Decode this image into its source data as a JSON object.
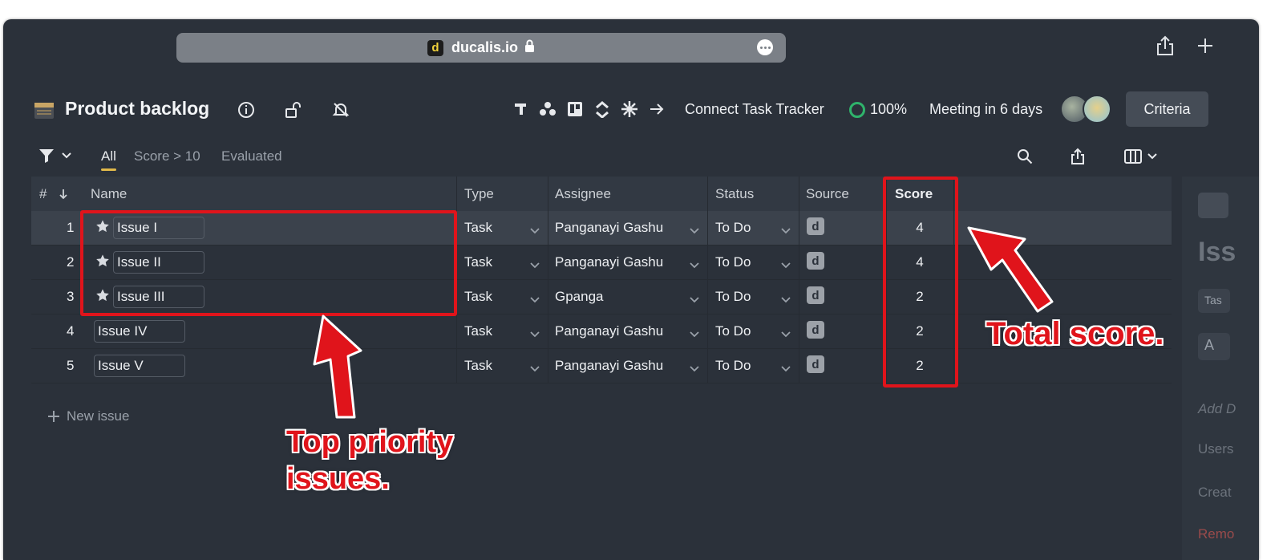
{
  "browser": {
    "url": "ducalis.io",
    "logo_letter": "d"
  },
  "header": {
    "title": "Product backlog",
    "connect_label": "Connect Task Tracker",
    "progress": "100%",
    "meeting": "Meeting in 6 days",
    "criteria_label": "Criteria"
  },
  "filters": {
    "tabs": [
      "All",
      "Score > 10",
      "Evaluated"
    ],
    "active": "All"
  },
  "table": {
    "columns": {
      "num": "#",
      "name": "Name",
      "type": "Type",
      "assignee": "Assignee",
      "status": "Status",
      "source": "Source",
      "score": "Score"
    },
    "rows": [
      {
        "num": "1",
        "name": "Issue I",
        "starred": true,
        "type": "Task",
        "assignee": "Panganayi Gashu",
        "status": "To Do",
        "source": "d",
        "score": "4"
      },
      {
        "num": "2",
        "name": "Issue II",
        "starred": true,
        "type": "Task",
        "assignee": "Panganayi Gashu",
        "status": "To Do",
        "source": "d",
        "score": "4"
      },
      {
        "num": "3",
        "name": "Issue III",
        "starred": true,
        "type": "Task",
        "assignee": "Gpanga",
        "status": "To Do",
        "source": "d",
        "score": "2"
      },
      {
        "num": "4",
        "name": "Issue IV",
        "starred": false,
        "type": "Task",
        "assignee": "Panganayi Gashu",
        "status": "To Do",
        "source": "d",
        "score": "2"
      },
      {
        "num": "5",
        "name": "Issue V",
        "starred": false,
        "type": "Task",
        "assignee": "Panganayi Gashu",
        "status": "To Do",
        "source": "d",
        "score": "2"
      }
    ],
    "new_issue": "New issue"
  },
  "side_panel": {
    "title_partial": "Iss",
    "tag_partial": "Tas",
    "add_partial": "A",
    "add_desc_partial": "Add D",
    "users_partial": "Users",
    "created_partial": "Creat",
    "remove_partial": "Remo"
  },
  "annotations": {
    "left_note": [
      "Top priority",
      "issues."
    ],
    "right_note": "Total score."
  },
  "colors": {
    "accent": "#e0b84a",
    "annotation_red": "#e0141b",
    "progress_green": "#2fb36b",
    "background": "#2b313a"
  }
}
